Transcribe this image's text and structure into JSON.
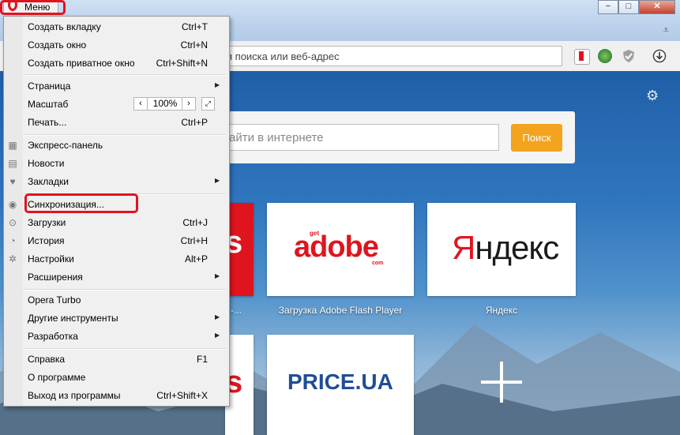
{
  "window": {
    "menu_label": "Меню",
    "controls": {
      "minimize": "−",
      "maximize": "□",
      "close": "✕"
    }
  },
  "address_bar": {
    "placeholder": "я поиска или веб-адрес"
  },
  "speed_dial": {
    "search_placeholder": "айти в интернете",
    "search_button": "Поиск",
    "tiles": [
      {
        "logo_get": "get",
        "logo_main": "adobe",
        "logo_com": "com",
        "label": "Загрузка Adobe Flash Player"
      },
      {
        "logo_first": "Я",
        "logo_rest": "ндекс",
        "label": "Яндекс"
      },
      {
        "logo": "PRICE.UA"
      }
    ],
    "partial_label": "l -...",
    "partial_logo_top": "s",
    "partial_logo_bottom": "s"
  },
  "menu": {
    "items": [
      {
        "label": "Создать вкладку",
        "shortcut": "Ctrl+T"
      },
      {
        "label": "Создать окно",
        "shortcut": "Ctrl+N"
      },
      {
        "label": "Создать приватное окно",
        "shortcut": "Ctrl+Shift+N"
      },
      {
        "label": "Страница"
      },
      {
        "label": "Масштаб",
        "zoom": "100%"
      },
      {
        "label": "Печать...",
        "shortcut": "Ctrl+P"
      },
      {
        "label": "Экспресс-панель"
      },
      {
        "label": "Новости"
      },
      {
        "label": "Закладки"
      },
      {
        "label": "Синхронизация..."
      },
      {
        "label": "Загрузки",
        "shortcut": "Ctrl+J"
      },
      {
        "label": "История",
        "shortcut": "Ctrl+H"
      },
      {
        "label": "Настройки",
        "shortcut": "Alt+P"
      },
      {
        "label": "Расширения"
      },
      {
        "label": "Opera Turbo"
      },
      {
        "label": "Другие инструменты"
      },
      {
        "label": "Разработка"
      },
      {
        "label": "Справка",
        "shortcut": "F1"
      },
      {
        "label": "О программе"
      },
      {
        "label": "Выход из программы",
        "shortcut": "Ctrl+Shift+X"
      }
    ],
    "zoom_decrease": "‹",
    "zoom_increase": "›"
  },
  "colors": {
    "highlight": "#e0141e",
    "search_button": "#f3a31d",
    "adobe": "#e0141e",
    "price": "#1f4e95"
  },
  "icons": [
    "opera-logo-icon",
    "gear-icon",
    "tabs-menu-icon",
    "speed-dial-icon",
    "news-icon",
    "heart-icon",
    "sync-icon",
    "download-icon",
    "history-icon",
    "settings-icon",
    "vpn-shield-icon",
    "globe-icon",
    "bookmark-icon"
  ]
}
